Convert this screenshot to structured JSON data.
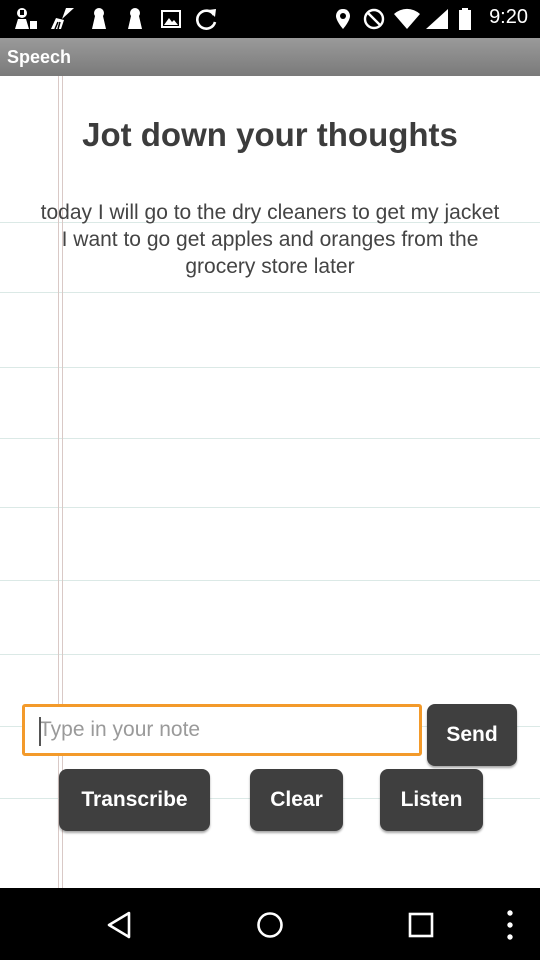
{
  "status_bar": {
    "time": "9:20",
    "left_icons": [
      "notification-icon",
      "broom-icon",
      "keyhole-icon",
      "keyhole-icon",
      "image-icon",
      "refresh-icon"
    ],
    "right_icons": [
      "location-icon",
      "do-not-disturb-icon",
      "wifi-icon",
      "signal-icon",
      "battery-icon"
    ]
  },
  "app_bar": {
    "title": "Speech"
  },
  "main": {
    "heading": "Jot down your thoughts",
    "note_lines": [
      "today I will go to the dry cleaners to get my jacket",
      "I want to go get apples and oranges from the",
      "grocery store later"
    ]
  },
  "input": {
    "placeholder": "Type in your note",
    "value": ""
  },
  "buttons": {
    "send": "Send",
    "transcribe": "Transcribe",
    "clear": "Clear",
    "listen": "Listen"
  },
  "nav_bar": {
    "icons": [
      "back-icon",
      "home-icon",
      "recents-icon",
      "overflow-menu-icon"
    ]
  },
  "colors": {
    "input_border": "#f39a2a",
    "button_bg": "#3f3f3f",
    "app_bar": "#8a8a8a"
  }
}
